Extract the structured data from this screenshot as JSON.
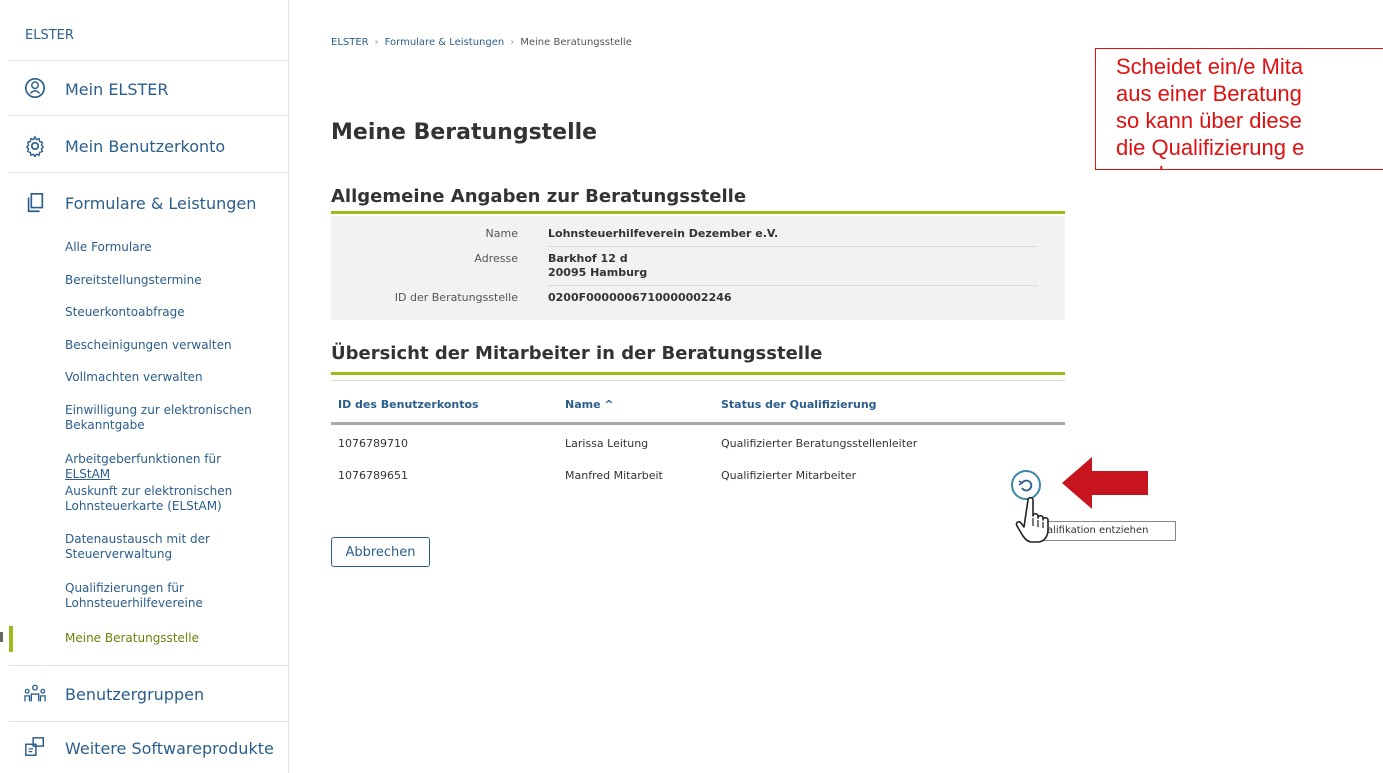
{
  "sidebar": {
    "top": "ELSTER",
    "main_items": [
      {
        "label": "Mein ELSTER",
        "icon": "user-circle-icon"
      },
      {
        "label": "Mein Benutzerkonto",
        "icon": "gear-icon"
      },
      {
        "label": "Formulare & Leistungen",
        "icon": "documents-icon"
      },
      {
        "label": "Benutzergruppen",
        "icon": "user-group-icon"
      },
      {
        "label": "Weitere Softwareprodukte",
        "icon": "software-icon"
      }
    ],
    "sub_items": [
      {
        "label": "Alle Formulare"
      },
      {
        "label": "Bereitstellungstermine"
      },
      {
        "label": "Steuerkontoabfrage"
      },
      {
        "label": "Bescheinigungen verwalten"
      },
      {
        "label": "Vollmachten verwalten"
      },
      {
        "label": "Einwilligung zur elektronischen Bekanntgabe"
      },
      {
        "label_prefix": "Arbeitgeberfunktionen für ",
        "label_link": "ELStAM"
      },
      {
        "label": "Auskunft zur elektronischen Lohnsteuerkarte (ELStAM)"
      },
      {
        "label": "Datenaustausch mit der Steuerverwaltung"
      },
      {
        "label": "Qualifizierungen für Lohnsteuerhilfevereine"
      },
      {
        "label": "Meine Beratungsstelle"
      }
    ]
  },
  "breadcrumb": [
    "ELSTER",
    "Formulare & Leistungen",
    "Meine Beratungsstelle"
  ],
  "page_title": "Meine Beratungstelle",
  "section_general": {
    "title": "Allgemeine Angaben zur Beratungsstelle",
    "name_label": "Name",
    "name_value": "Lohnsteuerhilfeverein Dezember e.V.",
    "address_label": "Adresse",
    "address_line1": "Barkhof 12 d",
    "address_line2": "20095 Hamburg",
    "id_label": "ID der Beratungsstelle",
    "id_value": "0200F0000006710000002246"
  },
  "section_staff": {
    "title": "Übersicht der Mitarbeiter in der Beratungsstelle",
    "headers": [
      "ID des Benutzerkontos",
      "Name ^",
      "Status der Qualifizierung"
    ],
    "rows": [
      [
        "1076789710",
        "Larissa Leitung",
        "Qualifizierter Beratungsstellenleiter"
      ],
      [
        "1076789651",
        "Manfred Mitarbeit",
        "Qualifizierter Mitarbeiter"
      ]
    ]
  },
  "revoke_tooltip": "alifikation entziehen",
  "cancel_label": "Abbrechen",
  "callout_lines": [
    "Scheidet ein/e  Mita",
    "aus einer Beratung",
    "so kann über diese",
    "die Qualifizierung e",
    "werden."
  ],
  "colors": {
    "link": "#2b5e8c",
    "accent": "#9cbb1b",
    "callout": "#d11111"
  }
}
